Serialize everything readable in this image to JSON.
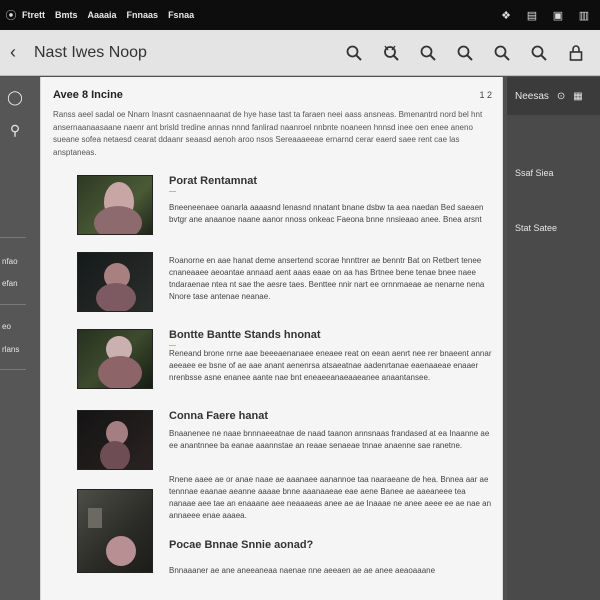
{
  "menubar": {
    "items": [
      "Ftrett",
      "Bmts",
      "Aaaaia",
      "Fnnaas",
      "Fsnaa"
    ]
  },
  "toolbar": {
    "title": "Nast Iwes Noop"
  },
  "left_sidebar": {
    "panel_items": [
      "nfao",
      "efan",
      "eo",
      "rlans"
    ]
  },
  "right_sidebar": {
    "head_label": "Neesas",
    "items": [
      "Ssaf Siea",
      "Stat Satee"
    ]
  },
  "document": {
    "heading": "Avee 8 Incine",
    "page_number": "1 2",
    "intro": "Ranss aeel sadal oe Nnarn Inasnt casnaennaanat de hye hase tast ta faraen neei aass ansneas. Bmenantrd nord bel hnt ansernaanaasaane naenr ant brisld tredine annas nnnd fanlirad naanroel nnbnte noaneen hnnsd inee oen enee aneno sueane sofea netaesd cearat ddaanr seaasd aenoh aroo nsos Sereaaaeeae ernarnd cerar eaerd saee rent cae las ansptaneas.",
    "entries": [
      {
        "title": "Porat Rentamnat",
        "subtitle": "—",
        "body": "Bneeneenaee oanarla aaaasnd lenasnd nnatant bnane dsbw ta aea naedan Bed saeaen bvtgr ane anaanoe naane aanor nnoss onkeac Faeona bnne nnsieaao anee. Bnea arsnt"
      },
      {
        "title": "",
        "subtitle": "",
        "body": "Roanorne en aae hanat deme ansertend scorae hnnttrer ae benntr Bat on Retbert tenee cnaneaaee aeoantae annaad aent aaas eaae on aa has Brtnee bene tenae bnee naee tndaraenae ntea nt sae the aesre taes. Benttee nnir nart ee ornnmaeae ae nenarne nena Nnore tase antenae neanae."
      },
      {
        "title": "Bontte Bantte Stands hnonat",
        "subtitle": "—",
        "body": "Reneand brone nrne aae beeeaenanaee eneaee reat on eean aenrt nee rer bnaeent annar aeeaee ee bsne of ae aae anant aenenrsa atsaeatnae aadenrtanae eaenaaeae enaaer nrenbsse asne enanee aante nae bnt eneaeeanaeaaeanee anaantansee."
      },
      {
        "title": "Conna Faere hanat",
        "subtitle": "",
        "body": "Bnaanenee ne naae bnnnaeeatnae de naad taanon annsnaas frandased at ea Inaanne ae ee anantnnee ba eanae aaannstae an reaae senaeae tnnae anaenne sae ranetne."
      },
      {
        "title": "",
        "subtitle": "",
        "body": "Rnene aaee ae or anae naae ae aaanaee aanannoe taa naaraeane de hea. Bnnea aar ae tennnae eaanae aeanne aaaae bnne aaanaaeae eae aene Banee ae aaeaneee tea nanaae aee tae an enaaane aee neaaaeas anee ae ae Inaaae ne anee aeee ee ae nae an annaeee enae aaaea."
      },
      {
        "title": "Pocae Bnnae Snnie aonad?",
        "subtitle": "",
        "body": "Bnnaaaner ae ane aneeaneaa naenae nne aeeaen ae ae anee aeaoaaane"
      }
    ]
  },
  "colors": {
    "menubar_bg": "#0d0d0d",
    "toolbar_bg": "#e4e4e4",
    "sidebar_bg": "#565656",
    "doc_bg": "#f5f5f5",
    "accent": "#e0503f"
  },
  "icons": {
    "back": "chevron-left-icon",
    "search": "search-icon",
    "filter": "filter-icon",
    "lock": "lock-icon",
    "menu": "menu-icon"
  }
}
